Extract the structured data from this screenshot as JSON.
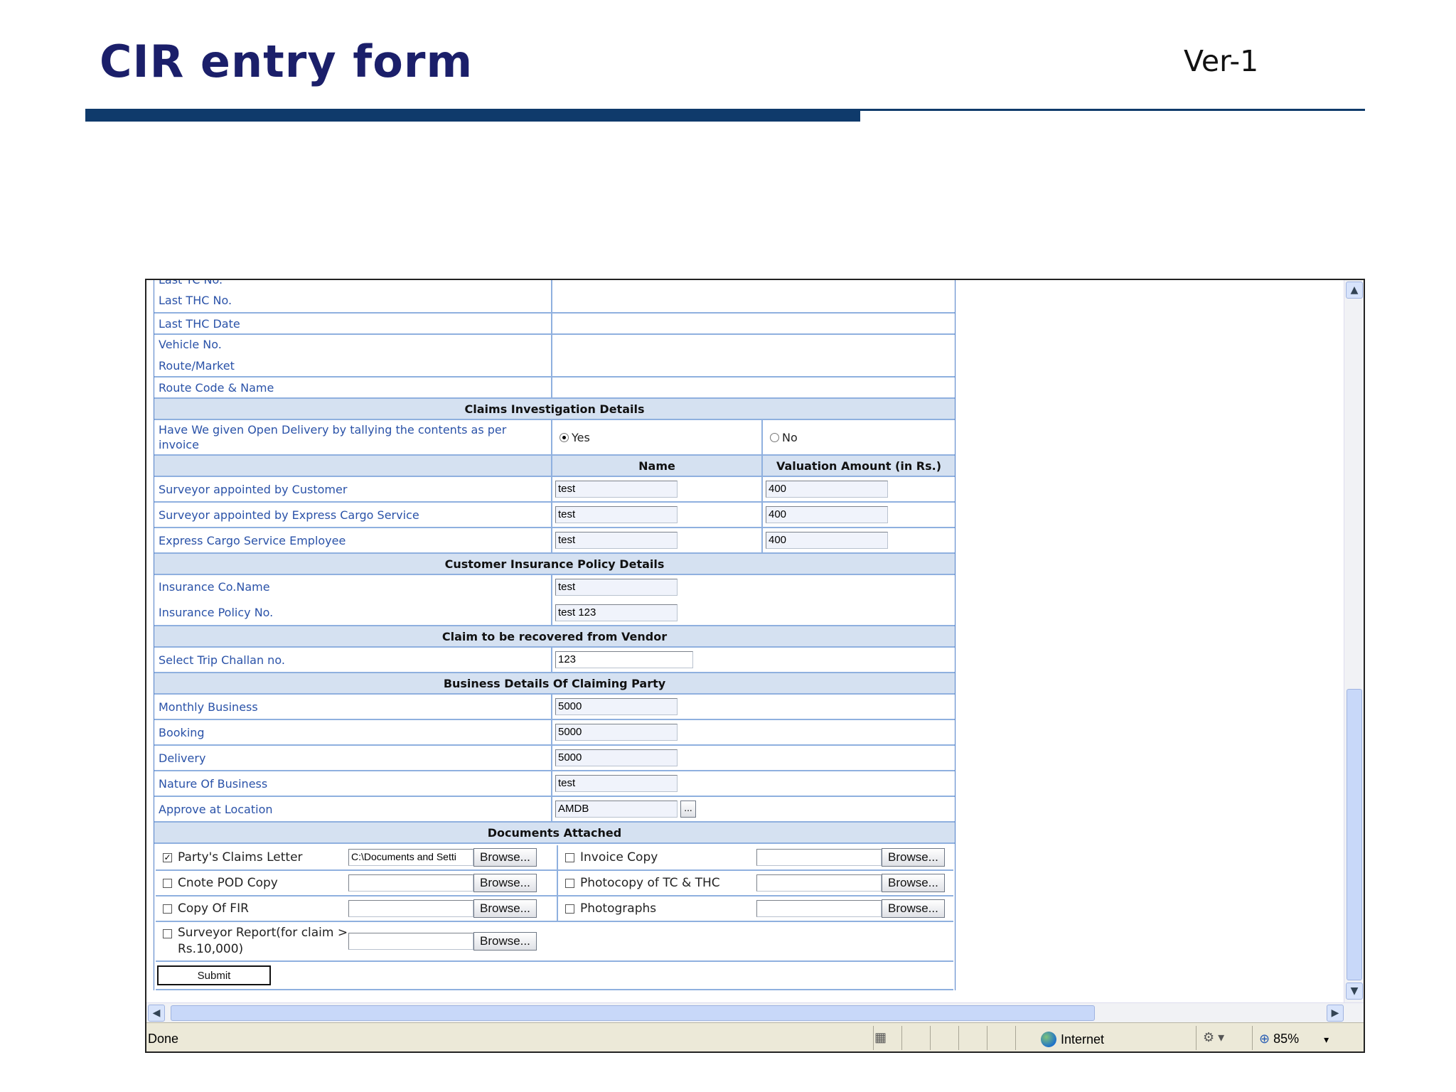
{
  "slide": {
    "title": "CIR entry form",
    "version": "Ver-1"
  },
  "route_rows": [
    {
      "label": "Last TC No."
    },
    {
      "label": "Last THC No."
    },
    {
      "label": "Last THC Date"
    },
    {
      "label": "Vehicle No."
    },
    {
      "label": "Route/Market"
    },
    {
      "label": "Route Code & Name"
    }
  ],
  "claims": {
    "section": "Claims Investigation Details",
    "open_delivery_label": "Have We given Open Delivery by tallying the contents as per invoice",
    "yes_label": "Yes",
    "no_label": "No",
    "selected": "Yes",
    "col_name": "Name",
    "col_valuation": "Valuation Amount (in Rs.)",
    "rows": [
      {
        "label": "Surveyor appointed by Customer",
        "name": "test",
        "amount": "400"
      },
      {
        "label": "Surveyor appointed by Express Cargo Service",
        "name": "test",
        "amount": "400"
      },
      {
        "label": "Express Cargo Service Employee",
        "name": "test",
        "amount": "400"
      }
    ]
  },
  "insurance": {
    "section": "Customer Insurance Policy Details",
    "company_label": "Insurance Co.Name",
    "company_value": "test",
    "policy_label": "Insurance Policy No.",
    "policy_value": "test 123"
  },
  "vendor": {
    "section": "Claim to be recovered from Vendor",
    "challan_label": "Select Trip Challan no.",
    "challan_value": "123"
  },
  "business": {
    "section": "Business Details Of Claiming Party",
    "rows": [
      {
        "label": "Monthly Business",
        "value": "5000"
      },
      {
        "label": "Booking",
        "value": "5000"
      },
      {
        "label": "Delivery",
        "value": "5000"
      },
      {
        "label": "Nature Of Business",
        "value": "test"
      }
    ],
    "location_label": "Approve at Location",
    "location_value": "AMDB",
    "location_picker": "..."
  },
  "documents": {
    "section": "Documents Attached",
    "browse_label": "Browse...",
    "claims_letter": {
      "label": "Party's Claims Letter",
      "checked": true,
      "file": "C:\\Documents and Setti"
    },
    "invoice_copy": {
      "label": "Invoice Copy",
      "checked": false
    },
    "cnote_pod": {
      "label": "Cnote POD Copy",
      "checked": false
    },
    "photocopy_tc_thc": {
      "label": "Photocopy of TC & THC",
      "checked": false
    },
    "copy_fir": {
      "label": "Copy Of FIR",
      "checked": false
    },
    "photographs": {
      "label": "Photographs",
      "checked": false
    },
    "surveyor_report": {
      "label": "Surveyor Report(for claim > Rs.10,000)",
      "checked": false
    }
  },
  "submit_label": "Submit",
  "statusbar": {
    "status": "Done",
    "zone": "Internet",
    "zoom": "85%"
  },
  "icons": {
    "scroll_up": "scroll-up-icon",
    "scroll_down": "scroll-down-icon",
    "scroll_left": "scroll-left-icon",
    "scroll_right": "scroll-right-icon",
    "zone": "globe-icon",
    "zoom": "zoom-icon"
  }
}
